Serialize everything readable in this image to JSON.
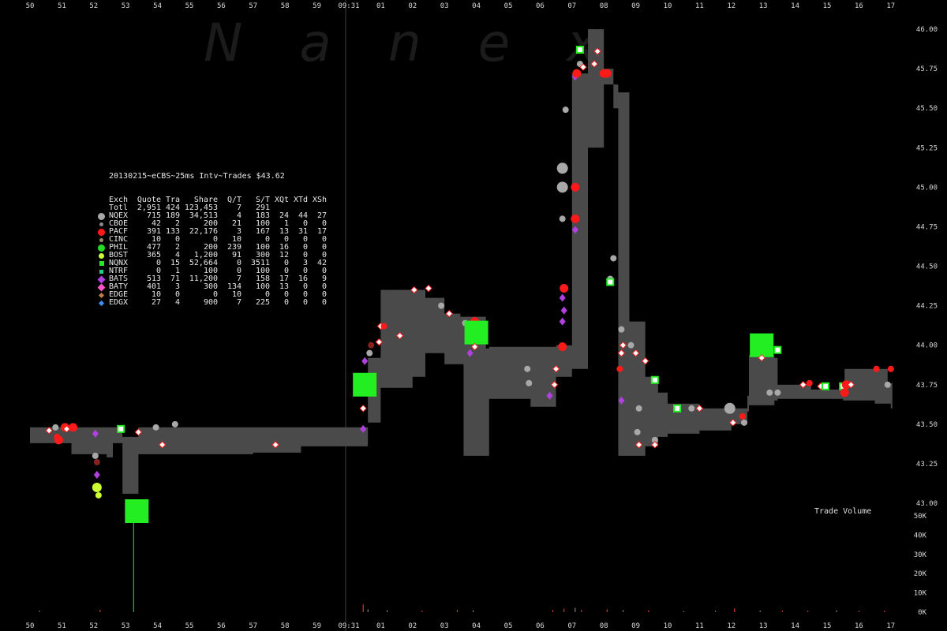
{
  "chart_data": {
    "type": "scatter",
    "title": "20130215~eCBS~25ms Intv~Trades $43.62",
    "watermark": "Nanex",
    "volume_label": "Trade Volume",
    "colors": {
      "background": "#000000",
      "band": "#4a4a4a",
      "axis_text": "#d8d8d8",
      "watermark": "#1a1a1a"
    },
    "x_ticks": [
      "50",
      "51",
      "52",
      "53",
      "54",
      "55",
      "56",
      "57",
      "58",
      "59",
      "09:31",
      "01",
      "02",
      "03",
      "04",
      "05",
      "06",
      "07",
      "08",
      "09",
      "10",
      "11",
      "12",
      "13",
      "14",
      "15",
      "16",
      "17"
    ],
    "y_price_ticks": [
      "46.00",
      "45.75",
      "45.50",
      "45.25",
      "45.00",
      "44.75",
      "44.50",
      "44.25",
      "44.00",
      "43.75",
      "43.50",
      "43.25",
      "43.00"
    ],
    "y_price_range": [
      43.0,
      46.0
    ],
    "y_volume_ticks": [
      "50K",
      "40K",
      "30K",
      "20K",
      "10K",
      "0K"
    ],
    "y_volume_range": [
      0,
      50000
    ],
    "legend": {
      "header": [
        "Exch",
        "Quote",
        "Tra",
        "Share",
        "Q/T",
        "S/T",
        "XQt",
        "XTd",
        "XSh"
      ],
      "total": [
        "Totl",
        "2,951",
        "424",
        "123,453",
        "7",
        "291",
        "",
        "",
        ""
      ],
      "rows": [
        {
          "cells": [
            "NQEX",
            "715",
            "189",
            "34,513",
            "4",
            "183",
            "24",
            "44",
            "27"
          ],
          "color": "#a8a8a8",
          "marker": "circle-big"
        },
        {
          "cells": [
            "CBOE",
            "42",
            "2",
            "200",
            "21",
            "100",
            "1",
            "0",
            "0"
          ],
          "color": "#8c8c8c",
          "marker": "circle-small"
        },
        {
          "cells": [
            "PACF",
            "391",
            "133",
            "22,176",
            "3",
            "167",
            "13",
            "31",
            "17"
          ],
          "color": "#ff1a1a",
          "marker": "circle-big"
        },
        {
          "cells": [
            "CINC",
            "10",
            "0",
            "0",
            "10",
            "0",
            "0",
            "0",
            "0"
          ],
          "color": "#9a8b6a",
          "marker": "circle-small"
        },
        {
          "cells": [
            "PHIL",
            "477",
            "2",
            "200",
            "239",
            "100",
            "16",
            "0",
            "0"
          ],
          "color": "#22dd22",
          "marker": "circle-big"
        },
        {
          "cells": [
            "BOST",
            "365",
            "4",
            "1,200",
            "91",
            "300",
            "12",
            "0",
            "0"
          ],
          "color": "#ccff33",
          "marker": "circle-mid"
        },
        {
          "cells": [
            "NQNX",
            "0",
            "15",
            "52,664",
            "0",
            "3511",
            "0",
            "3",
            "42"
          ],
          "color": "#22ee22",
          "marker": "square"
        },
        {
          "cells": [
            "NTRF",
            "0",
            "1",
            "100",
            "0",
            "100",
            "0",
            "0",
            "0"
          ],
          "color": "#22cc88",
          "marker": "square-small"
        },
        {
          "cells": [
            "BATS",
            "513",
            "71",
            "11,200",
            "7",
            "158",
            "17",
            "16",
            "9"
          ],
          "color": "#b040e0",
          "marker": "diamond"
        },
        {
          "cells": [
            "BATY",
            "401",
            "3",
            "300",
            "134",
            "100",
            "13",
            "0",
            "0"
          ],
          "color": "#ff55cc",
          "marker": "diamond"
        },
        {
          "cells": [
            "EDGE",
            "10",
            "0",
            "0",
            "10",
            "0",
            "0",
            "0",
            "0"
          ],
          "color": "#c08040",
          "marker": "diamond-small"
        },
        {
          "cells": [
            "EDGX",
            "27",
            "4",
            "900",
            "7",
            "225",
            "0",
            "0",
            "0"
          ],
          "color": "#4090ff",
          "marker": "diamond-small"
        }
      ]
    },
    "nbbo_band": [
      [
        0.0,
        43.38,
        43.48
      ],
      [
        1.2,
        43.38,
        43.48
      ],
      [
        1.3,
        43.31,
        43.48
      ],
      [
        2.4,
        43.29,
        43.48
      ],
      [
        2.6,
        43.38,
        43.48
      ],
      [
        2.9,
        43.06,
        43.42
      ],
      [
        3.35,
        43.06,
        43.42
      ],
      [
        3.4,
        43.31,
        43.48
      ],
      [
        7.0,
        43.32,
        43.48
      ],
      [
        8.5,
        43.36,
        43.48
      ],
      [
        10.5,
        43.36,
        43.48
      ],
      [
        10.6,
        43.51,
        43.92
      ],
      [
        11.0,
        43.73,
        44.35
      ],
      [
        12.0,
        43.8,
        44.35
      ],
      [
        12.4,
        43.95,
        44.3
      ],
      [
        13.0,
        43.88,
        44.2
      ],
      [
        13.5,
        43.88,
        44.18
      ],
      [
        13.6,
        43.3,
        44.18
      ],
      [
        14.3,
        43.3,
        43.98
      ],
      [
        14.4,
        43.66,
        43.99
      ],
      [
        15.0,
        43.66,
        43.99
      ],
      [
        15.7,
        43.61,
        43.99
      ],
      [
        16.2,
        43.61,
        43.99
      ],
      [
        16.5,
        43.8,
        44.0
      ],
      [
        17.0,
        43.85,
        45.72
      ],
      [
        17.5,
        45.25,
        46.0
      ],
      [
        18.0,
        45.65,
        45.75
      ],
      [
        18.3,
        45.5,
        45.65
      ],
      [
        18.45,
        43.3,
        45.6
      ],
      [
        18.8,
        43.3,
        44.15
      ],
      [
        19.3,
        43.36,
        43.8
      ],
      [
        19.7,
        43.42,
        43.7
      ],
      [
        20.0,
        43.44,
        43.63
      ],
      [
        21.0,
        43.46,
        43.6
      ],
      [
        22.0,
        43.5,
        43.6
      ],
      [
        22.5,
        43.58,
        43.68
      ],
      [
        22.55,
        43.62,
        43.94
      ],
      [
        23.0,
        43.62,
        43.94
      ],
      [
        23.35,
        43.65,
        43.92
      ],
      [
        23.45,
        43.66,
        43.75
      ],
      [
        24.5,
        43.66,
        43.72
      ],
      [
        25.0,
        43.66,
        43.72
      ],
      [
        25.5,
        43.65,
        43.72
      ],
      [
        25.55,
        43.65,
        43.85
      ],
      [
        26.5,
        43.63,
        43.85
      ],
      [
        26.9,
        43.63,
        43.76
      ],
      [
        27.0,
        43.6,
        43.76
      ]
    ],
    "trades": [
      {
        "x": 0.6,
        "y": 43.46,
        "k": "w"
      },
      {
        "x": 0.8,
        "y": 43.48,
        "k": "g"
      },
      {
        "x": 0.85,
        "y": 43.42,
        "k": "r"
      },
      {
        "x": 0.9,
        "y": 43.4,
        "k": "R"
      },
      {
        "x": 1.1,
        "y": 43.48,
        "k": "R"
      },
      {
        "x": 1.15,
        "y": 43.47,
        "k": "w"
      },
      {
        "x": 1.35,
        "y": 43.48,
        "k": "R"
      },
      {
        "x": 2.05,
        "y": 43.44,
        "k": "v"
      },
      {
        "x": 2.05,
        "y": 43.3,
        "k": "g"
      },
      {
        "x": 2.1,
        "y": 43.26,
        "k": "dr"
      },
      {
        "x": 2.1,
        "y": 43.18,
        "k": "v"
      },
      {
        "x": 2.1,
        "y": 43.1,
        "k": "y"
      },
      {
        "x": 2.15,
        "y": 43.05,
        "k": "yb"
      },
      {
        "x": 2.85,
        "y": 43.47,
        "k": "nq"
      },
      {
        "x": 3.35,
        "y": 42.95,
        "k": "NQ"
      },
      {
        "x": 3.4,
        "y": 43.45,
        "k": "w"
      },
      {
        "x": 3.95,
        "y": 43.48,
        "k": "g"
      },
      {
        "x": 4.15,
        "y": 43.37,
        "k": "w"
      },
      {
        "x": 4.55,
        "y": 43.5,
        "k": "g"
      },
      {
        "x": 7.7,
        "y": 43.37,
        "k": "w"
      },
      {
        "x": 10.45,
        "y": 43.47,
        "k": "v"
      },
      {
        "x": 10.45,
        "y": 43.6,
        "k": "w"
      },
      {
        "x": 10.5,
        "y": 43.75,
        "k": "NQ"
      },
      {
        "x": 10.5,
        "y": 43.9,
        "k": "v"
      },
      {
        "x": 10.65,
        "y": 43.95,
        "k": "g"
      },
      {
        "x": 10.7,
        "y": 44.0,
        "k": "dr"
      },
      {
        "x": 10.95,
        "y": 44.02,
        "k": "w"
      },
      {
        "x": 11.0,
        "y": 44.12,
        "k": "w"
      },
      {
        "x": 11.1,
        "y": 44.12,
        "k": "r"
      },
      {
        "x": 11.6,
        "y": 44.06,
        "k": "w"
      },
      {
        "x": 12.05,
        "y": 44.35,
        "k": "w"
      },
      {
        "x": 12.5,
        "y": 44.36,
        "k": "w"
      },
      {
        "x": 12.9,
        "y": 44.25,
        "k": "g"
      },
      {
        "x": 13.15,
        "y": 44.2,
        "k": "w"
      },
      {
        "x": 13.65,
        "y": 44.14,
        "k": "g"
      },
      {
        "x": 13.95,
        "y": 44.15,
        "k": "R"
      },
      {
        "x": 13.8,
        "y": 43.95,
        "k": "v"
      },
      {
        "x": 14.0,
        "y": 44.08,
        "k": "NQ"
      },
      {
        "x": 13.95,
        "y": 43.99,
        "k": "w"
      },
      {
        "x": 15.6,
        "y": 43.85,
        "k": "g"
      },
      {
        "x": 15.65,
        "y": 43.76,
        "k": "g"
      },
      {
        "x": 16.3,
        "y": 43.68,
        "k": "v"
      },
      {
        "x": 16.45,
        "y": 43.75,
        "k": "w"
      },
      {
        "x": 16.5,
        "y": 43.85,
        "k": "w"
      },
      {
        "x": 16.7,
        "y": 43.99,
        "k": "R"
      },
      {
        "x": 16.7,
        "y": 44.15,
        "k": "v"
      },
      {
        "x": 16.7,
        "y": 44.3,
        "k": "v"
      },
      {
        "x": 16.75,
        "y": 44.22,
        "k": "v"
      },
      {
        "x": 16.75,
        "y": 44.36,
        "k": "R"
      },
      {
        "x": 16.7,
        "y": 44.8,
        "k": "g"
      },
      {
        "x": 16.7,
        "y": 45.0,
        "k": "G"
      },
      {
        "x": 16.7,
        "y": 45.12,
        "k": "G"
      },
      {
        "x": 16.8,
        "y": 45.49,
        "k": "g"
      },
      {
        "x": 17.1,
        "y": 44.8,
        "k": "R"
      },
      {
        "x": 17.1,
        "y": 44.73,
        "k": "v"
      },
      {
        "x": 17.1,
        "y": 45.0,
        "k": "R"
      },
      {
        "x": 17.1,
        "y": 45.7,
        "k": "v"
      },
      {
        "x": 17.15,
        "y": 45.72,
        "k": "R"
      },
      {
        "x": 17.25,
        "y": 45.87,
        "k": "nq"
      },
      {
        "x": 17.25,
        "y": 45.78,
        "k": "g"
      },
      {
        "x": 17.35,
        "y": 45.76,
        "k": "w"
      },
      {
        "x": 17.7,
        "y": 45.78,
        "k": "w"
      },
      {
        "x": 17.8,
        "y": 45.86,
        "k": "w"
      },
      {
        "x": 18.0,
        "y": 45.72,
        "k": "R"
      },
      {
        "x": 18.1,
        "y": 45.72,
        "k": "R"
      },
      {
        "x": 18.3,
        "y": 44.55,
        "k": "g"
      },
      {
        "x": 18.2,
        "y": 44.42,
        "k": "g"
      },
      {
        "x": 18.2,
        "y": 44.4,
        "k": "nq"
      },
      {
        "x": 18.55,
        "y": 44.1,
        "k": "g"
      },
      {
        "x": 18.6,
        "y": 44.0,
        "k": "w"
      },
      {
        "x": 18.55,
        "y": 43.95,
        "k": "w"
      },
      {
        "x": 18.5,
        "y": 43.85,
        "k": "r"
      },
      {
        "x": 18.55,
        "y": 43.65,
        "k": "v"
      },
      {
        "x": 18.85,
        "y": 44.0,
        "k": "g"
      },
      {
        "x": 19.0,
        "y": 43.95,
        "k": "w"
      },
      {
        "x": 19.1,
        "y": 43.6,
        "k": "g"
      },
      {
        "x": 19.05,
        "y": 43.45,
        "k": "g"
      },
      {
        "x": 19.1,
        "y": 43.37,
        "k": "w"
      },
      {
        "x": 19.3,
        "y": 43.9,
        "k": "w"
      },
      {
        "x": 19.6,
        "y": 43.78,
        "k": "nq"
      },
      {
        "x": 19.6,
        "y": 43.4,
        "k": "g"
      },
      {
        "x": 19.6,
        "y": 43.37,
        "k": "w"
      },
      {
        "x": 20.3,
        "y": 43.6,
        "k": "nq"
      },
      {
        "x": 20.75,
        "y": 43.6,
        "k": "g"
      },
      {
        "x": 21.0,
        "y": 43.6,
        "k": "w"
      },
      {
        "x": 21.95,
        "y": 43.6,
        "k": "G"
      },
      {
        "x": 22.05,
        "y": 43.51,
        "k": "w"
      },
      {
        "x": 22.35,
        "y": 43.55,
        "k": "r"
      },
      {
        "x": 22.4,
        "y": 43.51,
        "k": "g"
      },
      {
        "x": 22.95,
        "y": 44.0,
        "k": "NQ"
      },
      {
        "x": 22.95,
        "y": 43.92,
        "k": "w"
      },
      {
        "x": 23.2,
        "y": 43.7,
        "k": "g"
      },
      {
        "x": 23.45,
        "y": 43.7,
        "k": "g"
      },
      {
        "x": 23.45,
        "y": 43.97,
        "k": "nq"
      },
      {
        "x": 24.25,
        "y": 43.75,
        "k": "w"
      },
      {
        "x": 24.45,
        "y": 43.76,
        "k": "r"
      },
      {
        "x": 24.8,
        "y": 43.74,
        "k": "w"
      },
      {
        "x": 24.95,
        "y": 43.74,
        "k": "nq"
      },
      {
        "x": 25.5,
        "y": 43.74,
        "k": "nq"
      },
      {
        "x": 25.55,
        "y": 43.7,
        "k": "R"
      },
      {
        "x": 25.6,
        "y": 43.75,
        "k": "R"
      },
      {
        "x": 25.75,
        "y": 43.75,
        "k": "w"
      },
      {
        "x": 26.55,
        "y": 43.85,
        "k": "r"
      },
      {
        "x": 26.9,
        "y": 43.75,
        "k": "g"
      },
      {
        "x": 27.0,
        "y": 43.85,
        "k": "r"
      }
    ],
    "volume_bars": [
      {
        "x": 3.25,
        "v": 50000,
        "k": "NQ"
      },
      {
        "x": 0.3,
        "v": 600,
        "k": "g"
      },
      {
        "x": 2.2,
        "v": 1200,
        "k": "r"
      },
      {
        "x": 10.45,
        "v": 4000,
        "k": "r"
      },
      {
        "x": 10.6,
        "v": 1500,
        "k": "g"
      },
      {
        "x": 11.2,
        "v": 900,
        "k": "g"
      },
      {
        "x": 12.3,
        "v": 700,
        "k": "r"
      },
      {
        "x": 13.4,
        "v": 1100,
        "k": "r"
      },
      {
        "x": 13.9,
        "v": 900,
        "k": "g"
      },
      {
        "x": 16.4,
        "v": 1000,
        "k": "r"
      },
      {
        "x": 16.75,
        "v": 1800,
        "k": "r"
      },
      {
        "x": 17.1,
        "v": 2200,
        "k": "g"
      },
      {
        "x": 17.3,
        "v": 1200,
        "k": "r"
      },
      {
        "x": 18.1,
        "v": 1400,
        "k": "r"
      },
      {
        "x": 18.6,
        "v": 1000,
        "k": "g"
      },
      {
        "x": 19.4,
        "v": 800,
        "k": "r"
      },
      {
        "x": 20.5,
        "v": 500,
        "k": "g"
      },
      {
        "x": 21.5,
        "v": 700,
        "k": "r"
      },
      {
        "x": 22.1,
        "v": 2000,
        "k": "r"
      },
      {
        "x": 22.9,
        "v": 800,
        "k": "g"
      },
      {
        "x": 23.6,
        "v": 600,
        "k": "r"
      },
      {
        "x": 24.4,
        "v": 700,
        "k": "r"
      },
      {
        "x": 25.3,
        "v": 900,
        "k": "g"
      },
      {
        "x": 26.0,
        "v": 600,
        "k": "r"
      },
      {
        "x": 26.8,
        "v": 700,
        "k": "r"
      }
    ]
  }
}
